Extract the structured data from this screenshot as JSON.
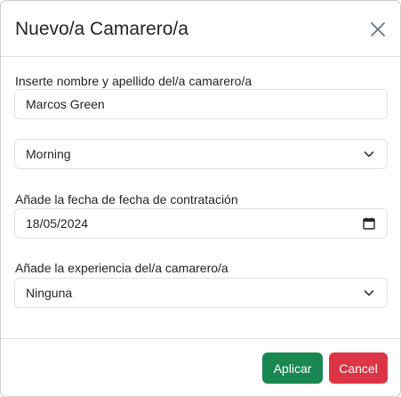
{
  "dialog": {
    "title": "Nuevo/a Camarero/a",
    "close_icon": "close-icon"
  },
  "form": {
    "name_label": "Inserte nombre y apellido del/a camarero/a",
    "name_value": "Marcos Green",
    "shift_value": "Morning",
    "hire_date_label": "Añade la fecha de fecha de contratación",
    "hire_date_value": "18/05/2024",
    "experience_label": "Añade la experiencia del/a camarero/a",
    "experience_value": "Ninguna"
  },
  "footer": {
    "apply_label": "Aplicar",
    "cancel_label": "Cancel"
  },
  "colors": {
    "apply": "#198754",
    "cancel": "#dc3545",
    "border": "#dee2e6"
  }
}
